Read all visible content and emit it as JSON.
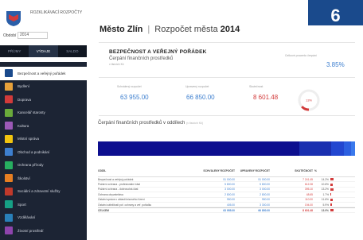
{
  "sidebar": {
    "logo_text": "ROZKLIKÁVACÍ ROZPOČTY",
    "period_label": "Období",
    "period_value": "2014",
    "tabs": [
      "PŘÍJMY",
      "VÝDAJE",
      "SALDO"
    ],
    "items": [
      {
        "label": "Bezpečnost a veřejný pořádek",
        "icon": "shield-icon",
        "color": "#1a4a8c"
      },
      {
        "label": "Bydlení",
        "icon": "house-icon",
        "color": "#e8a13a"
      },
      {
        "label": "Doprava",
        "icon": "car-icon",
        "color": "#d23a3a"
      },
      {
        "label": "Kancelář starosty",
        "icon": "office-icon",
        "color": "#6aaa3b"
      },
      {
        "label": "Kultura",
        "icon": "theater-icon",
        "color": "#9b59b6"
      },
      {
        "label": "Místní správa",
        "icon": "building-icon",
        "color": "#f1c40f"
      },
      {
        "label": "Obchod a podnikání",
        "icon": "shop-icon",
        "color": "#3d7fcf"
      },
      {
        "label": "Ochrana přírody",
        "icon": "tree-icon",
        "color": "#27ae60"
      },
      {
        "label": "Školství",
        "icon": "school-icon",
        "color": "#e67e22"
      },
      {
        "label": "Sociální a zdravotní služby",
        "icon": "health-icon",
        "color": "#c0392b"
      },
      {
        "label": "Sport",
        "icon": "ball-icon",
        "color": "#16a085"
      },
      {
        "label": "Vzdělávání",
        "icon": "book-icon",
        "color": "#2980b9"
      },
      {
        "label": "Životní prostředí",
        "icon": "leaf-icon",
        "color": "#8e44ad"
      }
    ]
  },
  "header": {
    "city": "Město Zlín",
    "label": "Rozpočet města",
    "year": "2014",
    "badge": "6"
  },
  "section": {
    "title": "BEZPEČNOST A VEŘEJNÝ POŘÁDEK",
    "subtitle": "Čerpání finančních prostředků",
    "subtitle_small": "v tisících Kč",
    "pct_label": "Celkové procento čerpání",
    "pct_value": "3.85%"
  },
  "kpis": [
    {
      "label": "Schválený rozpočet",
      "value": "63 955.00",
      "tone": "blue"
    },
    {
      "label": "Upravený rozpočet",
      "value": "66 850.00",
      "tone": "blue"
    },
    {
      "label": "Skutečnost",
      "value": "8 601.48",
      "tone": "red"
    }
  ],
  "gauge": {
    "value": "13%",
    "fill": 0.13,
    "color": "#d23a3a"
  },
  "chart": {
    "title": "Čerpání finančních prostředků v oddílech",
    "title_small": "(v tisících Kč)"
  },
  "table": {
    "headers": [
      "ODDÍL",
      "SCHVÁLENÝ ROZPOČET",
      "UPRAVENÝ ROZPOČET",
      "SKUTEČNOST",
      "%"
    ],
    "rows": [
      {
        "name": "Bezpečnost a veřejný pořádek",
        "schvaleny": "51 000.00",
        "upraveny": "51 000.00",
        "skutecnost": "7 241.45",
        "pct": "14.2%",
        "fill": 0.14
      },
      {
        "name": "Požární ochrana - profesionální část",
        "schvaleny": "5 800.00",
        "upraveny": "5 800.00",
        "skutecnost": "612.28",
        "pct": "10.6%",
        "fill": 0.11
      },
      {
        "name": "Požární ochrana - dobrovolná část",
        "schvaleny": "3 000.00",
        "upraveny": "3 000.00",
        "skutecnost": "395.10",
        "pct": "13.2%",
        "fill": 0.13
      },
      {
        "name": "Ochrana obyvatelstva",
        "schvaleny": "2 800.00",
        "upraveny": "2 800.00",
        "skutecnost": "48.65",
        "pct": "1.7%",
        "fill": 0.02
      },
      {
        "name": "Ostatní správa v oblasti krizového řízení",
        "schvaleny": "950.00",
        "upraveny": "950.00",
        "skutecnost": "110.00",
        "pct": "11.6%",
        "fill": 0.12
      },
      {
        "name": "Ostatní záležitosti poř. ochrany a veř. pořádku",
        "schvaleny": "405.00",
        "upraveny": "3 300.00",
        "skutecnost": "194.00",
        "pct": "5.9%",
        "fill": 0.06
      }
    ],
    "total": {
      "name": "CELKEM",
      "schvaleny": "63 955.00",
      "upraveny": "66 850.00",
      "skutecnost": "8 601.48",
      "pct": "13.0%",
      "fill": 0.13
    }
  }
}
